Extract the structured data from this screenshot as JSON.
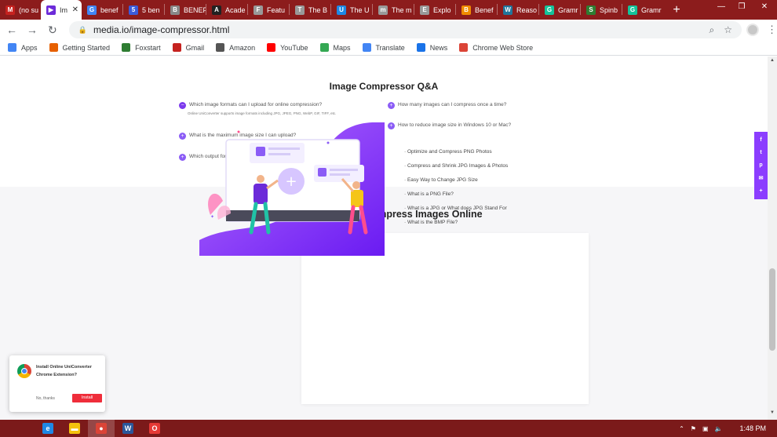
{
  "browser": {
    "tabs": [
      {
        "title": "(no su",
        "icon": "gmail-icon",
        "color": "#c5221f",
        "letter": "M"
      },
      {
        "title": "Im",
        "icon": "play-icon",
        "color": "#6c2bd9",
        "letter": "▶",
        "active": true
      },
      {
        "title": "benef",
        "icon": "google-icon",
        "color": "#4285f4",
        "letter": "G"
      },
      {
        "title": "5 ben",
        "icon": "flag-icon",
        "color": "#3b5bdb",
        "letter": "5"
      },
      {
        "title": "BENEF",
        "icon": "page-icon",
        "color": "#888888",
        "letter": "B"
      },
      {
        "title": "Acade",
        "icon": "academy-icon",
        "color": "#222222",
        "letter": "A"
      },
      {
        "title": "Featu",
        "icon": "globe-icon",
        "color": "#999999",
        "letter": "F"
      },
      {
        "title": "The B",
        "icon": "globe-icon",
        "color": "#999999",
        "letter": "T"
      },
      {
        "title": "The U",
        "icon": "site-icon",
        "color": "#1e88e5",
        "letter": "U"
      },
      {
        "title": "The m",
        "icon": "globe-icon",
        "color": "#999999",
        "letter": "m"
      },
      {
        "title": "Explo",
        "icon": "globe-icon",
        "color": "#999999",
        "letter": "E"
      },
      {
        "title": "Benef",
        "icon": "site-icon",
        "color": "#f08c00",
        "letter": "B"
      },
      {
        "title": "Reaso",
        "icon": "wordpress-icon",
        "color": "#21759b",
        "letter": "W"
      },
      {
        "title": "Gramr",
        "icon": "grammarly-icon",
        "color": "#15c39a",
        "letter": "G"
      },
      {
        "title": "Spinb",
        "icon": "spinbot-icon",
        "color": "#2e7d32",
        "letter": "S"
      },
      {
        "title": "Gramr",
        "icon": "grammarly-icon",
        "color": "#15c39a",
        "letter": "G"
      }
    ],
    "new_tab": "+",
    "url": "media.io/image-compressor.html",
    "bookmarks": [
      {
        "label": "Apps",
        "icon": "apps-grid-icon",
        "color": "#4285f4"
      },
      {
        "label": "Getting Started",
        "icon": "firefox-icon",
        "color": "#e66000"
      },
      {
        "label": "Foxstart",
        "icon": "globe-icon",
        "color": "#2e7d32"
      },
      {
        "label": "Gmail",
        "icon": "gmail-icon",
        "color": "#c5221f"
      },
      {
        "label": "Amazon",
        "icon": "globe-icon",
        "color": "#555555"
      },
      {
        "label": "YouTube",
        "icon": "youtube-icon",
        "color": "#ff0000"
      },
      {
        "label": "Maps",
        "icon": "maps-pin-icon",
        "color": "#34a853"
      },
      {
        "label": "Translate",
        "icon": "translate-icon",
        "color": "#4285f4"
      },
      {
        "label": "News",
        "icon": "news-icon",
        "color": "#1a73e8"
      },
      {
        "label": "Chrome Web Store",
        "icon": "webstore-icon",
        "color": "#db4437"
      }
    ]
  },
  "qa": {
    "title": "Image Compressor Q&A",
    "left_items": [
      {
        "text": "Which image formats can I upload for online compression?",
        "open": true
      },
      {
        "text": "What is the maximum image size I can upload?",
        "open": false
      },
      {
        "text": "Which output format can I choose after the images compressed?",
        "open": false
      }
    ],
    "answer": "Online UniConverter supports image formats including JPG, JPEG, PNG, WebP, GIF, TIFF, etc.",
    "right_items": [
      {
        "text": "How many images can I compress once a time?"
      },
      {
        "text": "How to reduce image size in Windows 10 or Mac?"
      }
    ]
  },
  "tips": {
    "title": "Tips & Tricks for Compress Images Online",
    "links": [
      "· Optimize and Compress PNG Photos",
      "· Compress and Shrink JPG Images & Photos",
      "· Easy Way to Change JPG Size",
      "· What is a PNG File?",
      "· What is a JPG or What does JPG Stand For",
      "· What is the BMP File?"
    ]
  },
  "social": [
    "f",
    "t",
    "p",
    "✉",
    "+"
  ],
  "popup": {
    "text": "Install Online UniConverter Chrome Extension?",
    "no": "No, thanks",
    "install": "Install"
  },
  "taskbar": {
    "time": "1:48 PM",
    "apps": [
      {
        "icon": "ie-icon",
        "color": "#1e88e5",
        "letter": "e"
      },
      {
        "icon": "file-explorer-icon",
        "color": "#f4c20d",
        "letter": "▬"
      },
      {
        "icon": "chrome-icon",
        "color": "#db4437",
        "letter": "●",
        "active": true
      },
      {
        "icon": "word-icon",
        "color": "#2b579a",
        "letter": "W"
      },
      {
        "icon": "opera-icon",
        "color": "#e53935",
        "letter": "O"
      }
    ]
  },
  "colors": {
    "accent": "#8b5cf6",
    "tabbar": "#8c1c1c",
    "taskbar": "#7b1a1a",
    "install": "#ef2d3a"
  }
}
